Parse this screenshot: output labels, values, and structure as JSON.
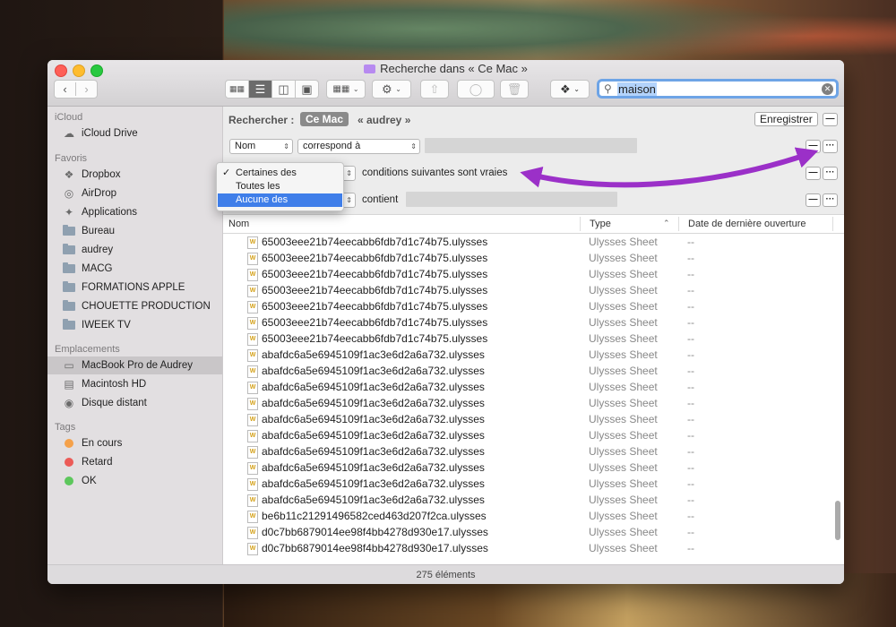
{
  "window": {
    "title": "Recherche dans « Ce Mac »"
  },
  "toolbar": {
    "back_icon": "chevron-left-icon",
    "forward_icon": "chevron-right-icon",
    "view_icons": [
      "icon-view-icon",
      "list-view-icon",
      "column-view-icon",
      "gallery-view-icon"
    ],
    "active_view": 1
  },
  "search": {
    "query": "maison"
  },
  "criteria": {
    "search_label": "Rechercher :",
    "scope_selected": "Ce Mac",
    "scope_other": "« audrey »",
    "save_label": "Enregistrer",
    "row1": {
      "attr": "Nom",
      "op": "correspond à"
    },
    "row2": {
      "text": "conditions suivantes sont vraies"
    },
    "row3": {
      "op": "contient"
    }
  },
  "dropdown": {
    "items": [
      "Certaines des",
      "Toutes les",
      "Aucune des"
    ],
    "checked_index": 0,
    "highlighted_index": 2
  },
  "sidebar": {
    "sections": [
      {
        "title": "iCloud",
        "items": [
          {
            "label": "iCloud Drive",
            "icon": "cloud-icon"
          }
        ]
      },
      {
        "title": "Favoris",
        "items": [
          {
            "label": "Dropbox",
            "icon": "dropbox-icon"
          },
          {
            "label": "AirDrop",
            "icon": "airdrop-icon"
          },
          {
            "label": "Applications",
            "icon": "applications-icon"
          },
          {
            "label": "Bureau",
            "icon": "folder-icon"
          },
          {
            "label": "audrey",
            "icon": "folder-icon"
          },
          {
            "label": "MACG",
            "icon": "folder-icon"
          },
          {
            "label": "FORMATIONS APPLE",
            "icon": "folder-icon"
          },
          {
            "label": "CHOUETTE PRODUCTION",
            "icon": "folder-icon"
          },
          {
            "label": "IWEEK TV",
            "icon": "folder-icon"
          }
        ]
      },
      {
        "title": "Emplacements",
        "items": [
          {
            "label": "MacBook Pro de Audrey",
            "icon": "laptop-icon",
            "selected": true
          },
          {
            "label": "Macintosh HD",
            "icon": "disk-icon"
          },
          {
            "label": "Disque distant",
            "icon": "optical-disk-icon"
          }
        ]
      },
      {
        "title": "Tags",
        "items": [
          {
            "label": "En cours",
            "color": "#f5a14a"
          },
          {
            "label": "Retard",
            "color": "#ec5b57"
          },
          {
            "label": "OK",
            "color": "#5dc75c"
          }
        ]
      }
    ]
  },
  "table": {
    "columns": [
      "Nom",
      "Type",
      "Date de dernière ouverture"
    ],
    "rows": [
      {
        "name": "65003eee21b74eecabb6fdb7d1c74b75.ulysses",
        "type": "Ulysses Sheet",
        "date": "--"
      },
      {
        "name": "65003eee21b74eecabb6fdb7d1c74b75.ulysses",
        "type": "Ulysses Sheet",
        "date": "--"
      },
      {
        "name": "65003eee21b74eecabb6fdb7d1c74b75.ulysses",
        "type": "Ulysses Sheet",
        "date": "--"
      },
      {
        "name": "65003eee21b74eecabb6fdb7d1c74b75.ulysses",
        "type": "Ulysses Sheet",
        "date": "--"
      },
      {
        "name": "65003eee21b74eecabb6fdb7d1c74b75.ulysses",
        "type": "Ulysses Sheet",
        "date": "--"
      },
      {
        "name": "65003eee21b74eecabb6fdb7d1c74b75.ulysses",
        "type": "Ulysses Sheet",
        "date": "--"
      },
      {
        "name": "65003eee21b74eecabb6fdb7d1c74b75.ulysses",
        "type": "Ulysses Sheet",
        "date": "--"
      },
      {
        "name": "abafdc6a5e6945109f1ac3e6d2a6a732.ulysses",
        "type": "Ulysses Sheet",
        "date": "--"
      },
      {
        "name": "abafdc6a5e6945109f1ac3e6d2a6a732.ulysses",
        "type": "Ulysses Sheet",
        "date": "--"
      },
      {
        "name": "abafdc6a5e6945109f1ac3e6d2a6a732.ulysses",
        "type": "Ulysses Sheet",
        "date": "--"
      },
      {
        "name": "abafdc6a5e6945109f1ac3e6d2a6a732.ulysses",
        "type": "Ulysses Sheet",
        "date": "--"
      },
      {
        "name": "abafdc6a5e6945109f1ac3e6d2a6a732.ulysses",
        "type": "Ulysses Sheet",
        "date": "--"
      },
      {
        "name": "abafdc6a5e6945109f1ac3e6d2a6a732.ulysses",
        "type": "Ulysses Sheet",
        "date": "--"
      },
      {
        "name": "abafdc6a5e6945109f1ac3e6d2a6a732.ulysses",
        "type": "Ulysses Sheet",
        "date": "--"
      },
      {
        "name": "abafdc6a5e6945109f1ac3e6d2a6a732.ulysses",
        "type": "Ulysses Sheet",
        "date": "--"
      },
      {
        "name": "abafdc6a5e6945109f1ac3e6d2a6a732.ulysses",
        "type": "Ulysses Sheet",
        "date": "--"
      },
      {
        "name": "abafdc6a5e6945109f1ac3e6d2a6a732.ulysses",
        "type": "Ulysses Sheet",
        "date": "--"
      },
      {
        "name": "be6b11c21291496582ced463d207f2ca.ulysses",
        "type": "Ulysses Sheet",
        "date": "--"
      },
      {
        "name": "d0c7bb6879014ee98f4bb4278d930e17.ulysses",
        "type": "Ulysses Sheet",
        "date": "--"
      },
      {
        "name": "d0c7bb6879014ee98f4bb4278d930e17.ulysses",
        "type": "Ulysses Sheet",
        "date": "--"
      }
    ]
  },
  "status": {
    "count": "275 éléments"
  },
  "annotation": {
    "arrow_color": "#9b30c8"
  }
}
